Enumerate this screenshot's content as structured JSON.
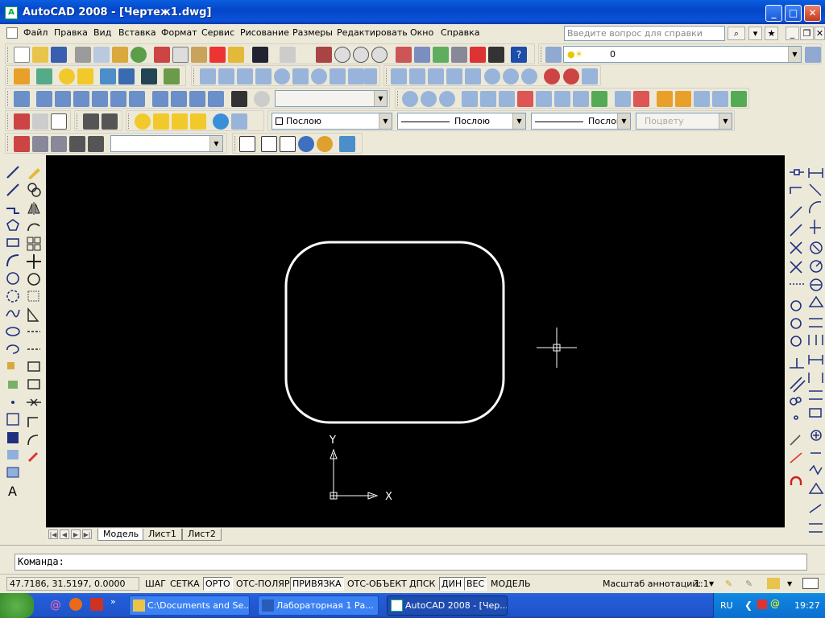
{
  "window": {
    "title": "AutoCAD 2008 - [Чертеж1.dwg]",
    "minimize": "_",
    "maximize": "□",
    "close": "✕"
  },
  "menu": {
    "items": [
      "Файл",
      "Правка",
      "Вид",
      "Вставка",
      "Формат",
      "Сервис",
      "Рисование",
      "Размеры",
      "Редактировать",
      "Окно",
      "Справка"
    ],
    "help_placeholder": "Введите вопрос для справки"
  },
  "toolbars": {
    "layer_value": "0",
    "color_combo": "Послою",
    "linetype_combo": "Послою",
    "lineweight_combo": "Послою",
    "plotstyle_combo": "Поцвету",
    "style_combo": ""
  },
  "canvas": {
    "background": "#000000",
    "ucs_x_label": "X",
    "ucs_y_label": "Y"
  },
  "layout_tabs": [
    "Модель",
    "Лист1",
    "Лист2"
  ],
  "command": {
    "prompt": "Команда:"
  },
  "status": {
    "coordinates": "47.7186, 31.5197, 0.0000",
    "toggles": [
      "ШАГ",
      "СЕТКА",
      "ОРТО",
      "ОТС-ПОЛЯР",
      "ПРИВЯЗКА",
      "ОТС-ОБЪЕКТ",
      "ДПСК",
      "ДИН",
      "ВЕС",
      "МОДЕЛЬ"
    ],
    "annotation_scale_label": "Масштаб аннотаций:",
    "annotation_scale_value": "1:1"
  },
  "taskbar": {
    "tasks": [
      {
        "label": "C:\\Documents and Se...",
        "icon": "folder-icon"
      },
      {
        "label": "Лабораторная 1  Ра...",
        "icon": "word-icon"
      },
      {
        "label": "AutoCAD 2008 - [Чер...",
        "icon": "autocad-icon"
      }
    ],
    "language": "RU",
    "clock": "19:27"
  }
}
